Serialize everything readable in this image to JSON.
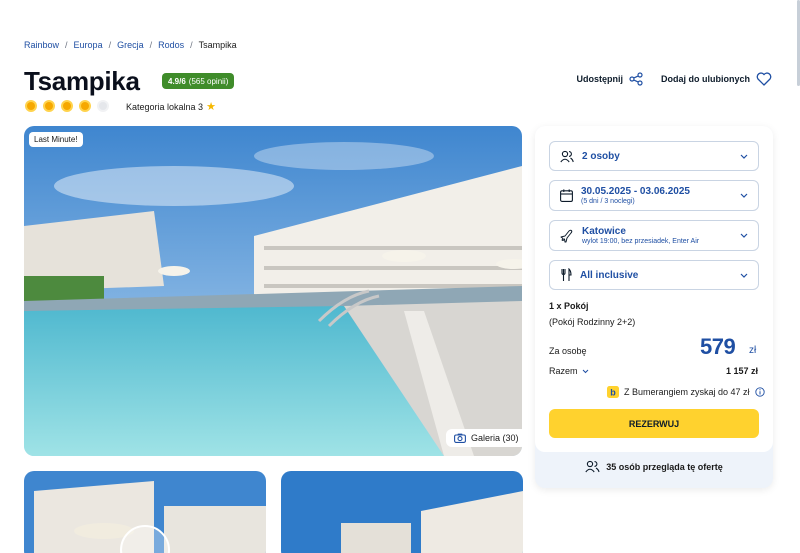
{
  "breadcrumb": [
    "Rainbow",
    "Europa",
    "Grecja",
    "Rodos",
    "Tsampika"
  ],
  "hotel": {
    "name": "Tsampika",
    "rating": "4.9/6",
    "reviews": "(565 opinii)",
    "suns": 4.5,
    "category_label": "Kategoria lokalna 3"
  },
  "actions": {
    "share": "Udostępnij",
    "favorite": "Dodaj do ulubionych"
  },
  "gallery": {
    "badge": "Last Minute!",
    "button": "Galeria (30)"
  },
  "booking": {
    "persons": "2 osoby",
    "dates": "30.05.2025 - 03.06.2025",
    "dates_sub": "(5 dni / 3 noclegi)",
    "departure": "Katowice",
    "departure_sub": "wylot 19:00, bez przesiadek, Enter Air",
    "board": "All inclusive",
    "room_count": "1 x Pokój",
    "room_type": "(Pokój Rodzinny 2+2)",
    "per_person_label": "Za osobę",
    "price": "579",
    "currency": "zł",
    "total_label": "Razem",
    "total_value": "1 157 zł",
    "bumerang": "Z Bumerangiem zyskaj do 47 zł",
    "reserve": "REZERWUJ",
    "viewers": "35 osób przegląda tę ofertę"
  },
  "colors": {
    "accent": "#1f4fa3",
    "cta": "#ffd22e",
    "rating": "#3f8c2a"
  }
}
